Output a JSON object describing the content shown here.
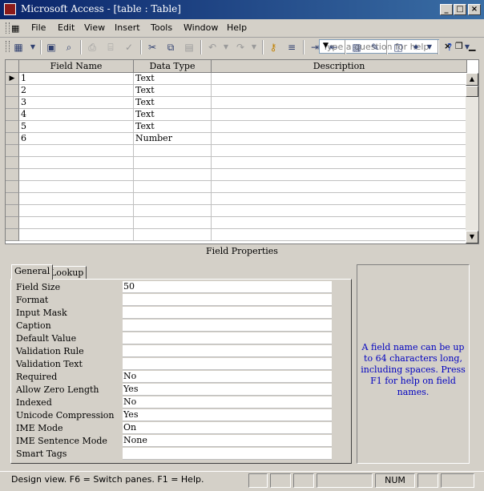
{
  "window": {
    "title": "Microsoft Access - [table : Table]"
  },
  "menu": {
    "items": [
      "File",
      "Edit",
      "View",
      "Insert",
      "Tools",
      "Window",
      "Help"
    ]
  },
  "help": {
    "placeholder": "Type a question for help"
  },
  "grid": {
    "headers": [
      "Field Name",
      "Data Type",
      "Description"
    ],
    "rows": [
      {
        "name": "1",
        "type": "Text",
        "desc": ""
      },
      {
        "name": "2",
        "type": "Text",
        "desc": ""
      },
      {
        "name": "3",
        "type": "Text",
        "desc": ""
      },
      {
        "name": "4",
        "type": "Text",
        "desc": ""
      },
      {
        "name": "5",
        "type": "Text",
        "desc": ""
      },
      {
        "name": "6",
        "type": "Number",
        "desc": ""
      }
    ]
  },
  "field_properties": {
    "title": "Field Properties",
    "tabs": [
      "General",
      "Lookup"
    ],
    "active_tab": "General",
    "props": [
      {
        "label": "Field Size",
        "value": "50"
      },
      {
        "label": "Format",
        "value": ""
      },
      {
        "label": "Input Mask",
        "value": ""
      },
      {
        "label": "Caption",
        "value": ""
      },
      {
        "label": "Default Value",
        "value": ""
      },
      {
        "label": "Validation Rule",
        "value": ""
      },
      {
        "label": "Validation Text",
        "value": ""
      },
      {
        "label": "Required",
        "value": "No"
      },
      {
        "label": "Allow Zero Length",
        "value": "Yes"
      },
      {
        "label": "Indexed",
        "value": "No"
      },
      {
        "label": "Unicode Compression",
        "value": "Yes"
      },
      {
        "label": "IME Mode",
        "value": "On"
      },
      {
        "label": "IME Sentence Mode",
        "value": "None"
      },
      {
        "label": "Smart Tags",
        "value": ""
      }
    ],
    "hint": "A field name can be up to 64 characters long, including spaces.  Press F1 for help on field names."
  },
  "status": {
    "text": "Design view.  F6 = Switch panes.  F1 = Help.",
    "num": "NUM"
  },
  "colors": {
    "title_start": "#0a246a",
    "title_end": "#3a6ea5",
    "hint_text": "#0000c0",
    "face": "#d4d0c8"
  }
}
